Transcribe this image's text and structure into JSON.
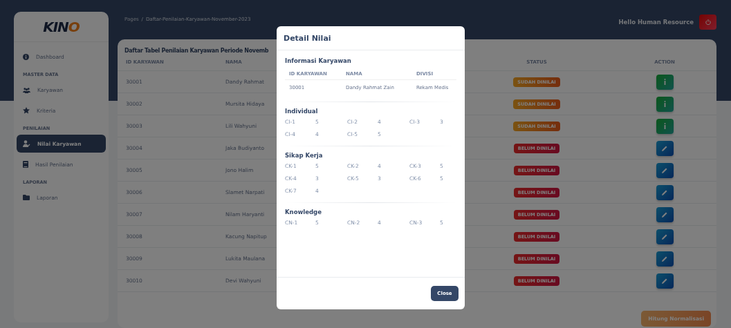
{
  "brand": {
    "logo": "KINO"
  },
  "breadcrumb": {
    "root": "Pages",
    "separator": "/",
    "current": "Daftar-Penilaian-Karyawan-November-2023"
  },
  "user": {
    "greeting": "Hello Human Resource"
  },
  "sidebar": {
    "items": [
      {
        "kind": "link",
        "label": "Dashboard",
        "selected": false
      },
      {
        "kind": "heading",
        "label": "MASTER DATA"
      },
      {
        "kind": "link",
        "label": "Karyawan",
        "selected": false
      },
      {
        "kind": "link",
        "label": "Kriteria",
        "selected": false
      },
      {
        "kind": "heading",
        "label": "PENILAIAN"
      },
      {
        "kind": "link",
        "label": "Nilai Karyawan",
        "selected": true
      },
      {
        "kind": "link",
        "label": "Hasil Penilaian",
        "selected": false
      },
      {
        "kind": "heading",
        "label": "LAPORAN"
      },
      {
        "kind": "link",
        "label": "Laporan",
        "selected": false
      }
    ]
  },
  "table": {
    "title": "Daftar Tabel Penilaian Karyawan Periode Novemb",
    "columns": [
      "ID KARYAWAN",
      "NAMA",
      "STATUS",
      "ACTION"
    ],
    "rows": [
      {
        "id": "30001",
        "name": "Dandy Rahmat",
        "status": {
          "label": "SUDAH DINILAI",
          "kind": "done"
        },
        "action": {
          "kind": "info"
        }
      },
      {
        "id": "30002",
        "name": "Mursita Hidaya",
        "status": {
          "label": "SUDAH DINILAI",
          "kind": "done"
        },
        "action": {
          "kind": "info"
        }
      },
      {
        "id": "30003",
        "name": "Lili Wahyuni",
        "status": {
          "label": "SUDAH DINILAI",
          "kind": "done"
        },
        "action": {
          "kind": "info"
        }
      },
      {
        "id": "30004",
        "name": "Jaka Budiyanto",
        "status": {
          "label": "BELUM DINILAI",
          "kind": "pending"
        },
        "action": {
          "kind": "edit"
        }
      },
      {
        "id": "30005",
        "name": "Jono Halim",
        "status": {
          "label": "BELUM DINILAI",
          "kind": "pending"
        },
        "action": {
          "kind": "edit"
        }
      },
      {
        "id": "30006",
        "name": "Slamet Narpati",
        "status": {
          "label": "BELUM DINILAI",
          "kind": "pending"
        },
        "action": {
          "kind": "edit"
        }
      },
      {
        "id": "30007",
        "name": "Nilam Haryanti",
        "status": {
          "label": "BELUM DINILAI",
          "kind": "pending"
        },
        "action": {
          "kind": "edit"
        }
      },
      {
        "id": "30008",
        "name": "Kacung Napitup",
        "status": {
          "label": "BELUM DINILAI",
          "kind": "pending"
        },
        "action": {
          "kind": "edit"
        }
      },
      {
        "id": "30009",
        "name": "Lukita Maulana",
        "status": {
          "label": "BELUM DINILAI",
          "kind": "pending"
        },
        "action": {
          "kind": "edit"
        }
      },
      {
        "id": "30010",
        "name": "Devi Wahyuni",
        "status": {
          "label": "BELUM DINILAI",
          "kind": "pending"
        },
        "action": {
          "kind": "edit"
        }
      }
    ]
  },
  "footer_button": "Hitung Normalisasi",
  "modal": {
    "title": "Detail Nilai",
    "info_title": "Informasi Karyawan",
    "info_columns": [
      "ID KARYAWAN",
      "NAMA",
      "DIVISI"
    ],
    "info_values": [
      "30001",
      "Dandy Rahmat Zain",
      "Rekam Medis"
    ],
    "sections": [
      {
        "title": "Individual",
        "scores": [
          {
            "code": "CI-1",
            "value": "5"
          },
          {
            "code": "CI-2",
            "value": "4"
          },
          {
            "code": "CI-3",
            "value": "3"
          },
          {
            "code": "CI-4",
            "value": "4"
          },
          {
            "code": "CI-5",
            "value": "5"
          }
        ]
      },
      {
        "title": "Sikap Kerja",
        "scores": [
          {
            "code": "CK-1",
            "value": "5"
          },
          {
            "code": "CK-2",
            "value": "4"
          },
          {
            "code": "CK-3",
            "value": "5"
          },
          {
            "code": "CK-4",
            "value": "3"
          },
          {
            "code": "CK-5",
            "value": "3"
          },
          {
            "code": "CK-6",
            "value": "5"
          },
          {
            "code": "CK-7",
            "value": "4"
          }
        ]
      },
      {
        "title": "Knowledge",
        "scores": [
          {
            "code": "CN-1",
            "value": "5"
          },
          {
            "code": "CN-2",
            "value": "4"
          },
          {
            "code": "CN-3",
            "value": "5"
          }
        ]
      }
    ],
    "close_button": "Close"
  }
}
